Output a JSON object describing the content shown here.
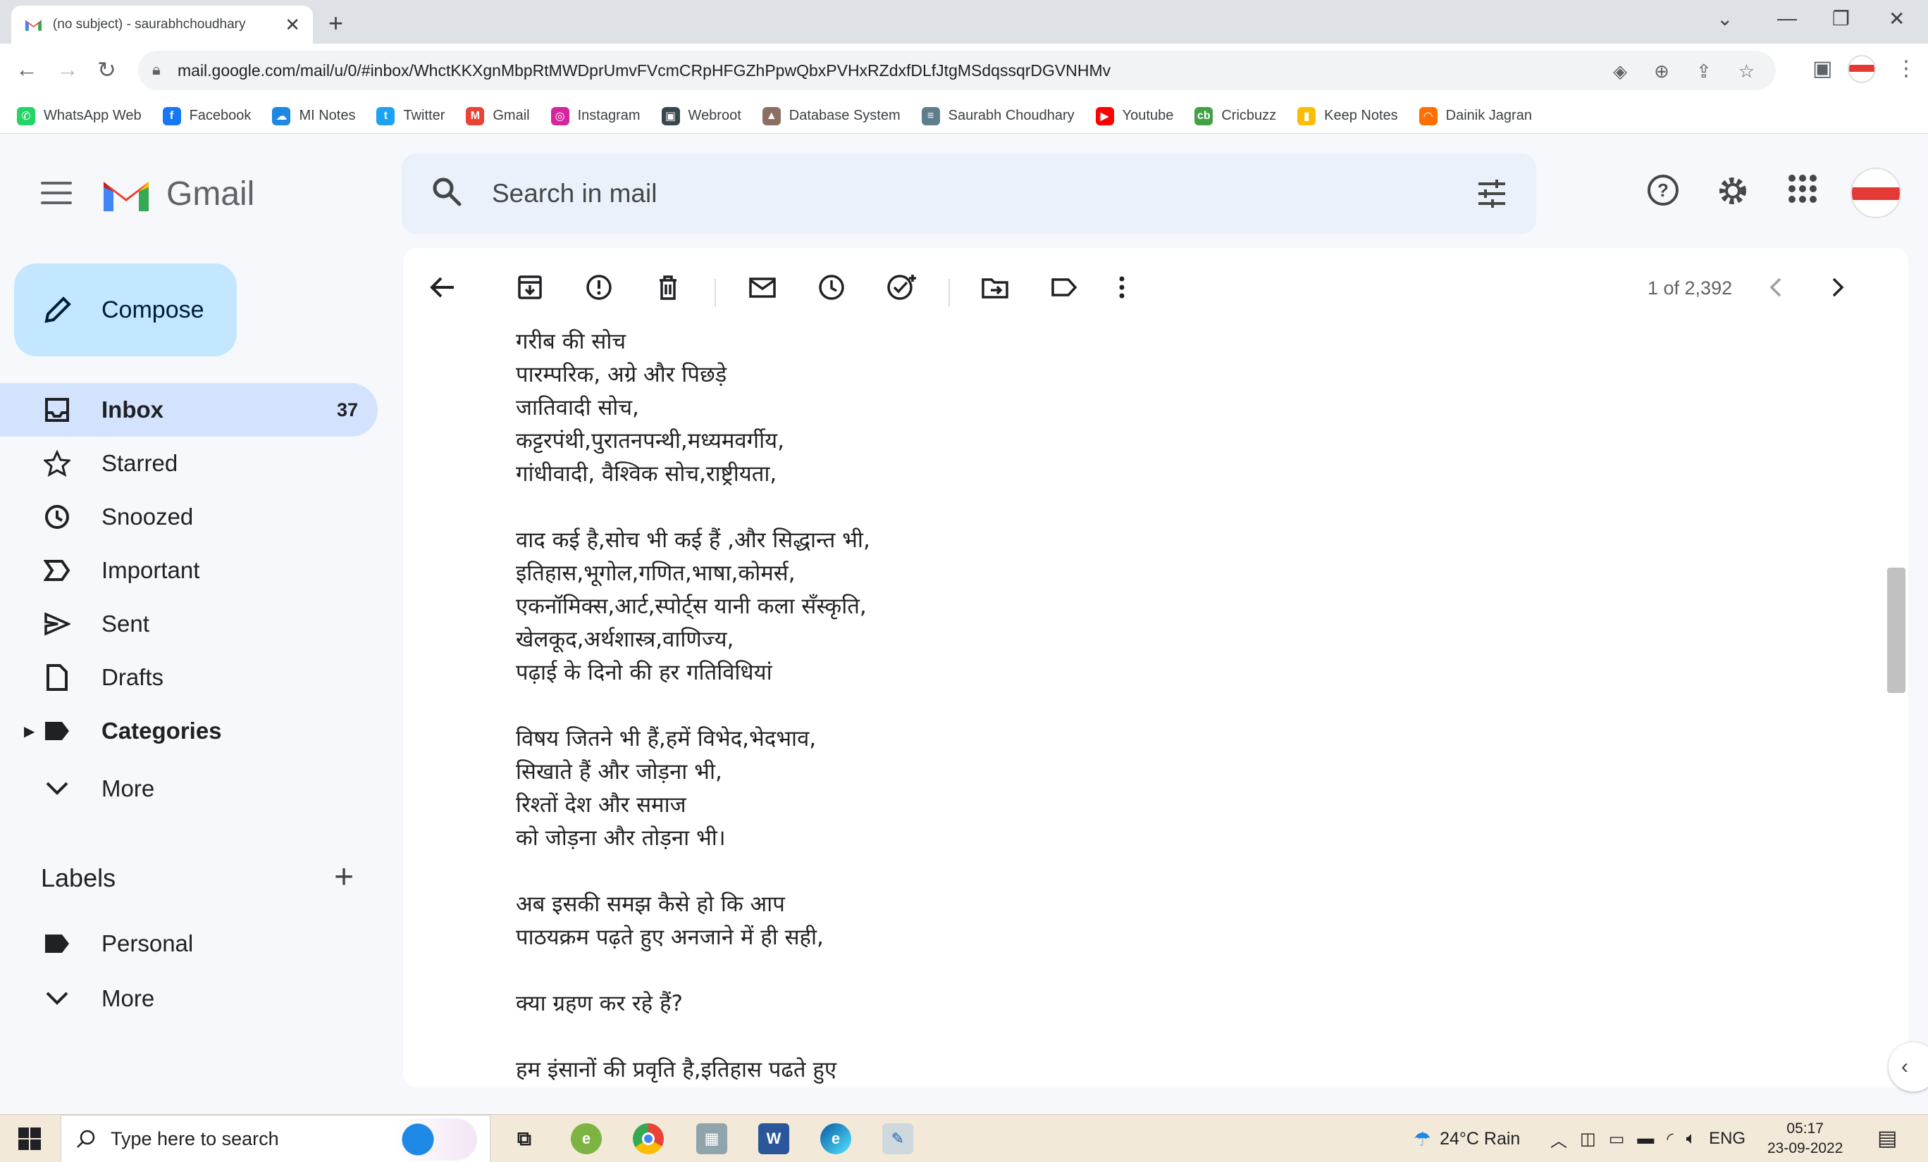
{
  "browser": {
    "tab_title": "(no subject) - saurabhchoudhary",
    "url": "mail.google.com/mail/u/0/#inbox/WhctKKXgnMbpRtMWDprUmvFVcmCRpHFGZhPpwQbxPVHxRZdxfDLfJtgMSdqssqrDGVNHMv",
    "bookmarks": [
      {
        "label": "WhatsApp Web",
        "color": "#25d366",
        "glyph": "✆"
      },
      {
        "label": "Facebook",
        "color": "#1877f2",
        "glyph": "f"
      },
      {
        "label": "MI Notes",
        "color": "#1e88e5",
        "glyph": "☁"
      },
      {
        "label": "Twitter",
        "color": "#1da1f2",
        "glyph": "t"
      },
      {
        "label": "Gmail",
        "color": "#ea4335",
        "glyph": "M"
      },
      {
        "label": "Instagram",
        "color": "#d6249f",
        "glyph": "◎"
      },
      {
        "label": "Webroot",
        "color": "#37474f",
        "glyph": "▣"
      },
      {
        "label": "Database System",
        "color": "#8d6e63",
        "glyph": "▲"
      },
      {
        "label": "Saurabh Choudhary",
        "color": "#607d8b",
        "glyph": "≡"
      },
      {
        "label": "Youtube",
        "color": "#ff0000",
        "glyph": "▶"
      },
      {
        "label": "Cricbuzz",
        "color": "#43a047",
        "glyph": "cb"
      },
      {
        "label": "Keep Notes",
        "color": "#fbbc04",
        "glyph": "▮"
      },
      {
        "label": "Dainik Jagran",
        "color": "#ff6f00",
        "glyph": "◠"
      }
    ]
  },
  "gmail": {
    "brand": "Gmail",
    "search_placeholder": "Search in mail",
    "compose_label": "Compose",
    "nav": [
      {
        "label": "Inbox",
        "count": "37"
      },
      {
        "label": "Starred"
      },
      {
        "label": "Snoozed"
      },
      {
        "label": "Important"
      },
      {
        "label": "Sent"
      },
      {
        "label": "Drafts"
      },
      {
        "label": "Categories"
      },
      {
        "label": "More"
      }
    ],
    "labels_title": "Labels",
    "labels": [
      {
        "label": "Personal"
      },
      {
        "label": "More"
      }
    ],
    "pager": "1 of 2,392",
    "body_lines": [
      "गरीब की सोच",
      "पारम्परिक, अग्रे और पिछड़े",
      "जातिवादी सोच,",
      "कट्टरपंथी,पुरातनपन्थी,मध्यमवर्गीय,",
      "गांधीवादी, वैश्विक सोच,राष्ट्रीयता,",
      "",
      "वाद कई है,सोच भी कई हैं ,और सिद्धान्त भी,",
      "इतिहास,भूगोल,गणित,भाषा,कोमर्स,",
      "एकनॉमिक्स,आर्ट,स्पोर्ट्स यानी कला सँस्कृति,",
      "खेलकूद,अर्थशास्त्र,वाणिज्य,",
      "पढ़ाई के दिनो की हर गतिविधियां",
      "",
      "विषय जितने भी हैं,हमें विभेद,भेदभाव,",
      "सिखाते हैं और जोड़ना भी,",
      "रिश्तों देश और समाज",
      "को जोड़ना और तोड़ना भी।",
      "",
      "अब इसकी समझ कैसे हो कि आप",
      "पाठयक्रम पढ़ते हुए अनजाने में ही सही,",
      "",
      "क्या ग्रहण कर रहे हैं?",
      "",
      "हम इंसानों की प्रवृति है,इतिहास पढते हुए"
    ]
  },
  "taskbar": {
    "search_placeholder": "Type here to search",
    "weather": "24°C Rain",
    "language": "ENG",
    "time": "05:17",
    "date": "23-09-2022"
  }
}
